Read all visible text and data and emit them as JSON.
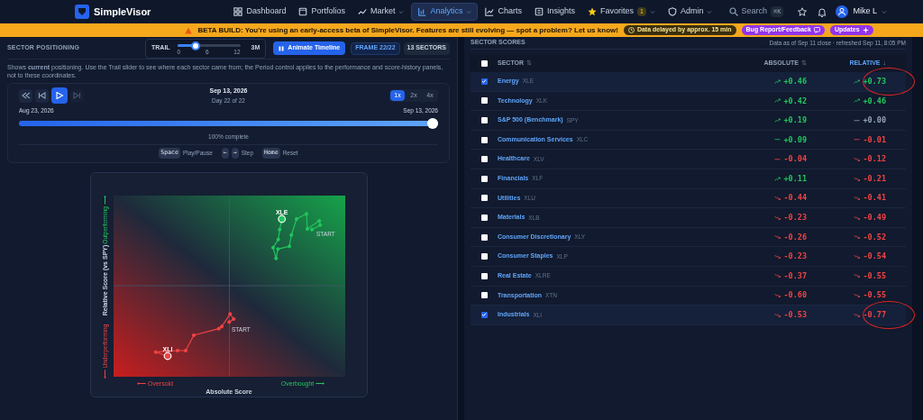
{
  "nav": {
    "brand": "SimpleVisor",
    "items": [
      {
        "label": "Dashboard",
        "selected": false,
        "caret": false
      },
      {
        "label": "Portfolios",
        "selected": false,
        "caret": false
      },
      {
        "label": "Market",
        "selected": false,
        "caret": true
      },
      {
        "label": "Analytics",
        "selected": true,
        "caret": true
      },
      {
        "label": "Charts",
        "selected": false,
        "caret": false
      },
      {
        "label": "Insights",
        "selected": false,
        "caret": false
      },
      {
        "label": "Favorites",
        "selected": false,
        "caret": true,
        "badge": "1"
      },
      {
        "label": "Admin",
        "selected": false,
        "caret": true
      }
    ],
    "search": {
      "placeholder": "Search",
      "shortcut": "⌘K"
    },
    "user": {
      "name": "Mike L"
    }
  },
  "banner": {
    "text": "BETA BUILD: You're using an early-access beta of SimpleVisor. Features are still evolving — spot a problem? Let us know!",
    "pills": [
      {
        "kind": "info",
        "label": "Data delayed by approx. 15 min"
      },
      {
        "kind": "feedback",
        "label": "Bug Report/Feedback"
      },
      {
        "kind": "updates",
        "label": "Updates"
      }
    ]
  },
  "positioning": {
    "title": "SECTOR POSITIONING",
    "trail": {
      "label": "TRAIL",
      "level": 0.29,
      "ticks": [
        "0",
        "6",
        "12"
      ],
      "max": "3M"
    },
    "animate_button": "Animate Timeline",
    "frame_badge": "FRAME 22/22",
    "sectors_badge": "13 SECTORS",
    "description": "Shows **current** positioning. Use the Trail slider to see where each sector came from; the Period control applies to the performance and score-history panels, not to these coordinates.",
    "player": {
      "controls": [
        {
          "kind": "rewind",
          "selected": false,
          "disabled": false
        },
        {
          "kind": "back",
          "selected": false,
          "disabled": false
        },
        {
          "kind": "play",
          "selected": true,
          "disabled": false
        },
        {
          "kind": "forward",
          "selected": false,
          "disabled": true
        }
      ],
      "date": "Sep 13, 2026",
      "day": "Day 22 of 22",
      "speeds": [
        {
          "label": "1x",
          "selected": true
        },
        {
          "label": "2x",
          "selected": false
        },
        {
          "label": "4x",
          "selected": false
        }
      ],
      "start_date": "Aug 23, 2026",
      "end_date": "Sep 13, 2026",
      "level": 1,
      "progress_text": "100% complete",
      "shortcuts": [
        {
          "keys": [
            "Space"
          ],
          "label": "Play/Pause"
        },
        {
          "keys": [
            "←",
            "→"
          ],
          "label": "Step"
        },
        {
          "keys": [
            "Home"
          ],
          "label": "Reset"
        }
      ]
    },
    "chart": {
      "ylabel": "Relative Score (vs SPY)",
      "xlabel": "Absolute Score",
      "top_label": "Outperforming ⟶",
      "bottom_label": "⟵ Underperforming",
      "left_label": "⟵ Oversold",
      "right_label": "Overbought ⟶",
      "series": [
        {
          "ticker": "XLE",
          "color": "#22c55e",
          "start_label": "START"
        },
        {
          "ticker": "XLI",
          "color": "#ef4444",
          "start_label": "START"
        }
      ]
    }
  },
  "scores": {
    "title": "SECTOR SCORES",
    "updated": "Data as of Sep 11 close · refreshed Sep 11, 8:05 PM",
    "all_selected": false,
    "columns": [
      {
        "label": "SECTOR",
        "sort_glyph": "⇅",
        "sorted": false
      },
      {
        "label": "ABSOLUTE",
        "sort_glyph": "⇅",
        "sorted": false
      },
      {
        "label": "RELATIVE",
        "sort_glyph": "↓",
        "sorted": true
      }
    ],
    "rows": [
      {
        "name": "Energy",
        "ticker": "XLE",
        "selected": true,
        "circled": true,
        "absolute": {
          "value": "+0.46",
          "kind": "up",
          "color": "#22c55e"
        },
        "relative": {
          "value": "+0.73",
          "kind": "up",
          "color": "#22c55e"
        }
      },
      {
        "name": "Technology",
        "ticker": "XLK",
        "selected": false,
        "circled": false,
        "absolute": {
          "value": "+0.42",
          "kind": "up",
          "color": "#22c55e"
        },
        "relative": {
          "value": "+0.46",
          "kind": "up",
          "color": "#22c55e"
        }
      },
      {
        "name": "S&P 500 (Benchmark)",
        "ticker": "SPY",
        "selected": false,
        "circled": false,
        "absolute": {
          "value": "+0.19",
          "kind": "up",
          "color": "#22c55e"
        },
        "relative": {
          "value": "+0.00",
          "kind": "flat",
          "color": "#94a3b8"
        }
      },
      {
        "name": "Communication Services",
        "ticker": "XLC",
        "selected": false,
        "circled": false,
        "absolute": {
          "value": "+0.09",
          "kind": "flat",
          "color": "#22c55e"
        },
        "relative": {
          "value": "-0.01",
          "kind": "flat",
          "color": "#ef4444"
        }
      },
      {
        "name": "Healthcare",
        "ticker": "XLV",
        "selected": false,
        "circled": false,
        "absolute": {
          "value": "-0.04",
          "kind": "flat",
          "color": "#ef4444"
        },
        "relative": {
          "value": "-0.12",
          "kind": "down",
          "color": "#ef4444"
        }
      },
      {
        "name": "Financials",
        "ticker": "XLF",
        "selected": false,
        "circled": false,
        "absolute": {
          "value": "+0.11",
          "kind": "up",
          "color": "#22c55e"
        },
        "relative": {
          "value": "-0.21",
          "kind": "down",
          "color": "#ef4444"
        }
      },
      {
        "name": "Utilities",
        "ticker": "XLU",
        "selected": false,
        "circled": false,
        "absolute": {
          "value": "-0.44",
          "kind": "down",
          "color": "#ef4444"
        },
        "relative": {
          "value": "-0.41",
          "kind": "down",
          "color": "#ef4444"
        }
      },
      {
        "name": "Materials",
        "ticker": "XLB",
        "selected": false,
        "circled": false,
        "absolute": {
          "value": "-0.23",
          "kind": "down",
          "color": "#ef4444"
        },
        "relative": {
          "value": "-0.49",
          "kind": "down",
          "color": "#ef4444"
        }
      },
      {
        "name": "Consumer Discretionary",
        "ticker": "XLY",
        "selected": false,
        "circled": false,
        "absolute": {
          "value": "-0.26",
          "kind": "down",
          "color": "#ef4444"
        },
        "relative": {
          "value": "-0.52",
          "kind": "down",
          "color": "#ef4444"
        }
      },
      {
        "name": "Consumer Staples",
        "ticker": "XLP",
        "selected": false,
        "circled": false,
        "absolute": {
          "value": "-0.23",
          "kind": "down",
          "color": "#ef4444"
        },
        "relative": {
          "value": "-0.54",
          "kind": "down",
          "color": "#ef4444"
        }
      },
      {
        "name": "Real Estate",
        "ticker": "XLRE",
        "selected": false,
        "circled": false,
        "absolute": {
          "value": "-0.37",
          "kind": "down",
          "color": "#ef4444"
        },
        "relative": {
          "value": "-0.55",
          "kind": "down",
          "color": "#ef4444"
        }
      },
      {
        "name": "Transportation",
        "ticker": "XTN",
        "selected": false,
        "circled": false,
        "absolute": {
          "value": "-0.60",
          "kind": "down",
          "color": "#ef4444"
        },
        "relative": {
          "value": "-0.55",
          "kind": "down",
          "color": "#ef4444"
        }
      },
      {
        "name": "Industrials",
        "ticker": "XLI",
        "selected": true,
        "circled": true,
        "absolute": {
          "value": "-0.53",
          "kind": "down",
          "color": "#ef4444"
        },
        "relative": {
          "value": "-0.77",
          "kind": "down",
          "color": "#ef4444"
        }
      }
    ]
  }
}
